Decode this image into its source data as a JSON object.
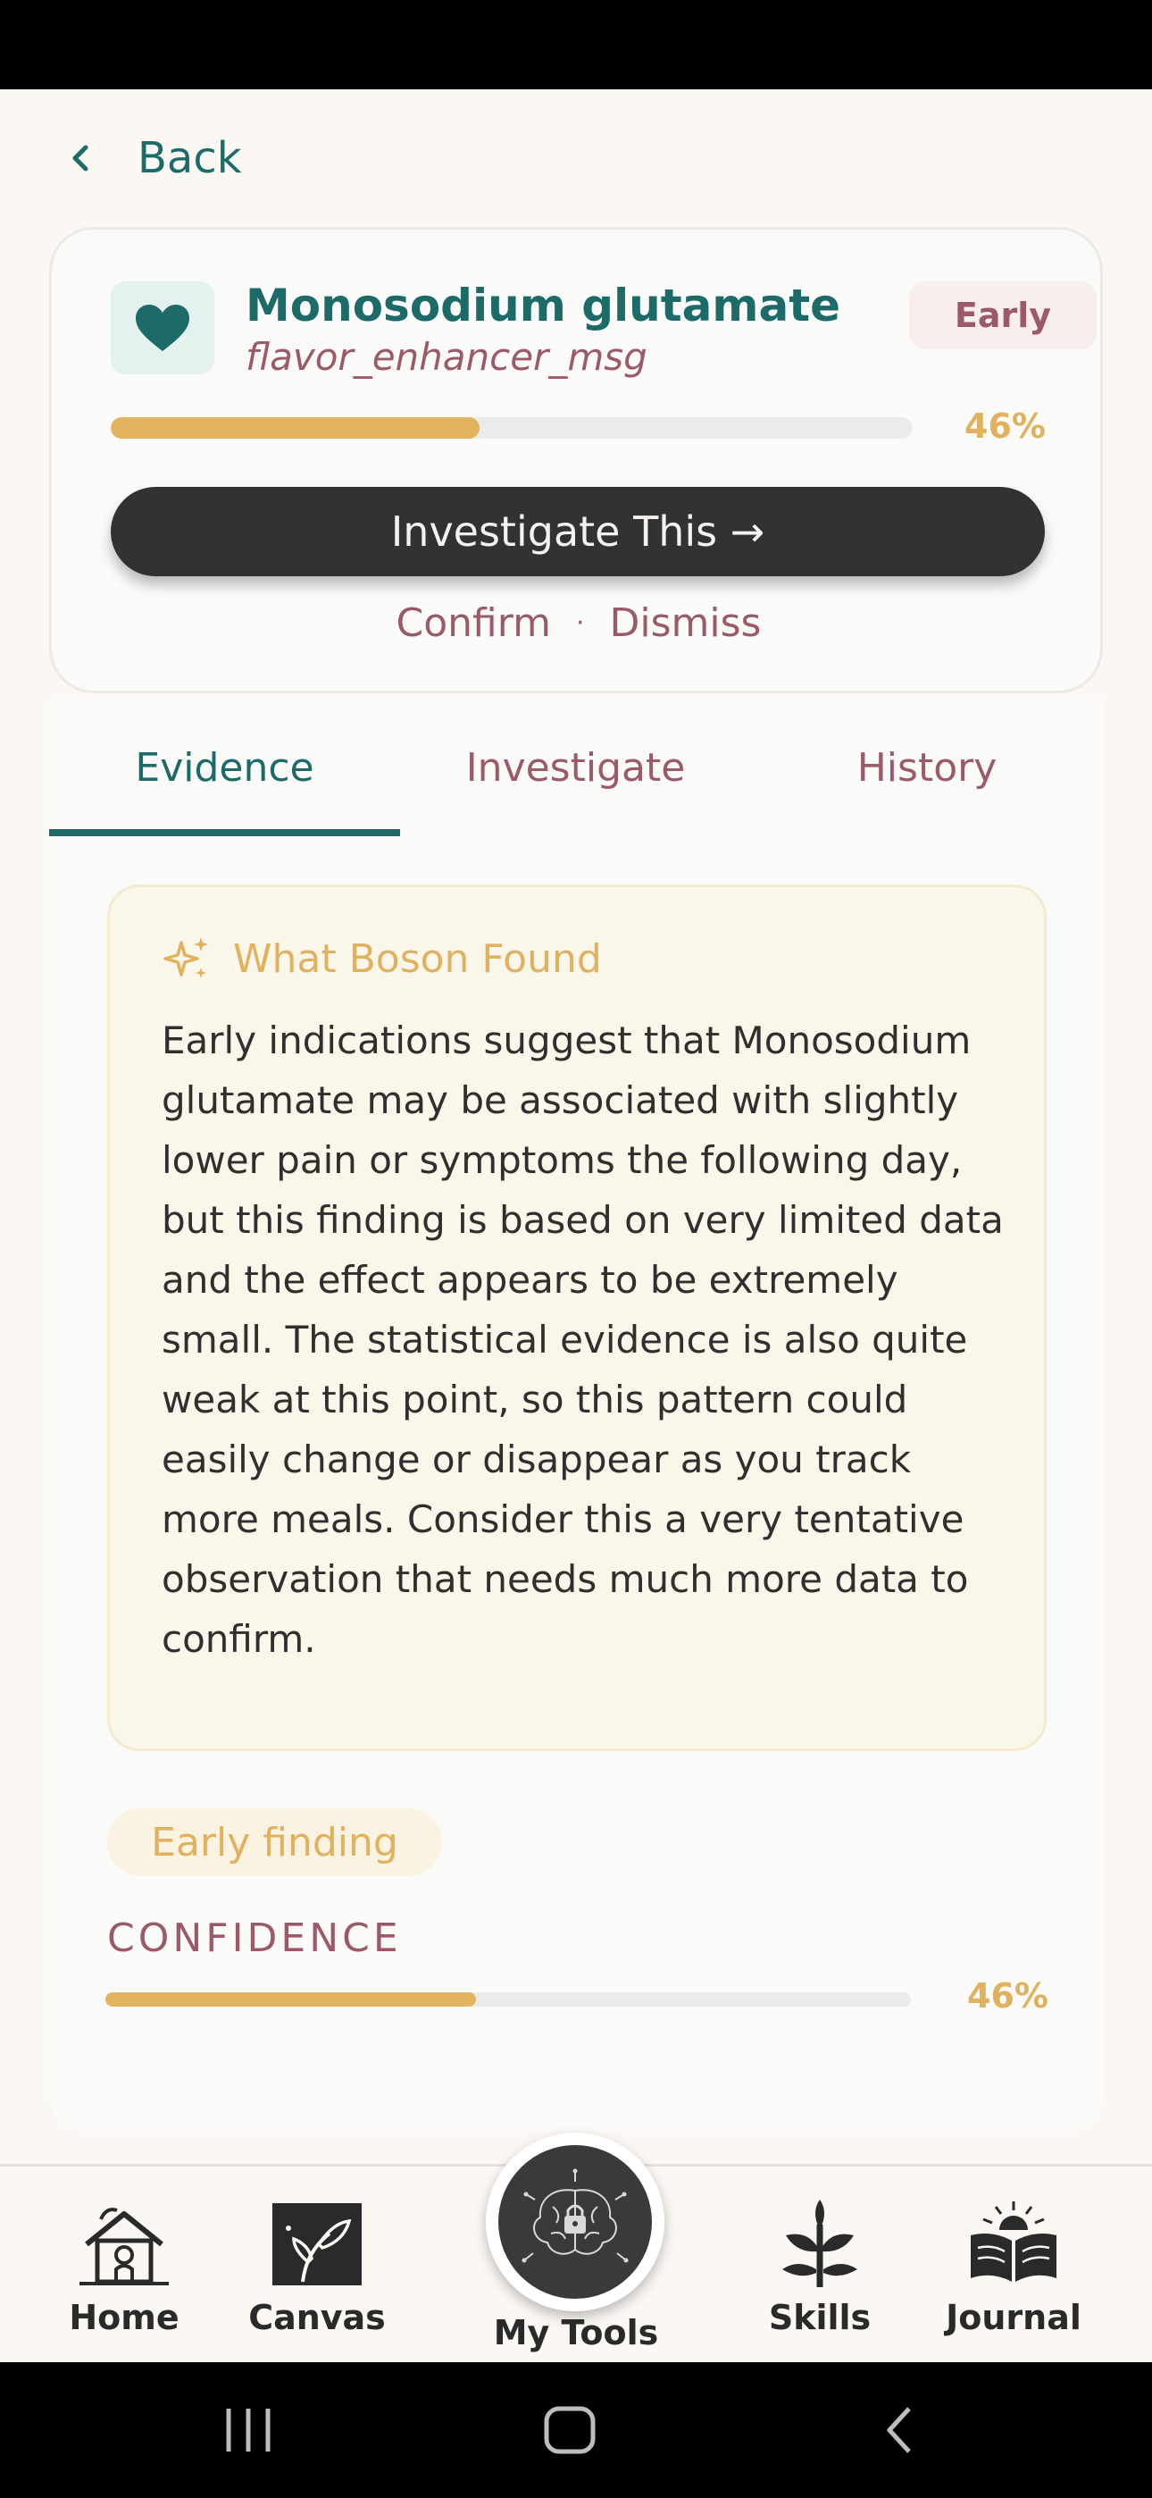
{
  "header": {
    "back_label": "Back"
  },
  "finding": {
    "title": "Monosodium glutamate",
    "id": "flavor_enhancer_msg",
    "stage": "Early",
    "progress": 0.46,
    "progress_label": "46%",
    "primary_action": "Investigate This →",
    "confirm_label": "Confirm",
    "separator": "·",
    "dismiss_label": "Dismiss"
  },
  "tabs": [
    {
      "label": "Evidence",
      "active": true
    },
    {
      "label": "Investigate",
      "active": false
    },
    {
      "label": "History",
      "active": false
    }
  ],
  "boson": {
    "title": "What Boson Found",
    "body": "Early indications suggest that Monosodium glutamate may be associated with slightly lower pain or symptoms the following day, but this finding is based on very limited data and the effect appears to be extremely small. The statistical evidence is also quite weak at this point, so this pattern could easily change or disappear as you track more meals. Consider this a very tentative observation that needs much more data to confirm."
  },
  "confidence": {
    "chip": "Early finding",
    "label": "CONFIDENCE",
    "value": 0.46,
    "value_label": "46%"
  },
  "bottom_nav": [
    {
      "label": "Home",
      "icon": "house-icon"
    },
    {
      "label": "Canvas",
      "icon": "canvas-icon"
    },
    {
      "label": "My Tools",
      "icon": "brain-lock-icon"
    },
    {
      "label": "Skills",
      "icon": "plant-icon"
    },
    {
      "label": "Journal",
      "icon": "open-book-icon"
    }
  ],
  "colors": {
    "teal": "#1c6b68",
    "rose": "#9a5a6c",
    "gold": "#e0b15e",
    "dark": "#323232"
  }
}
